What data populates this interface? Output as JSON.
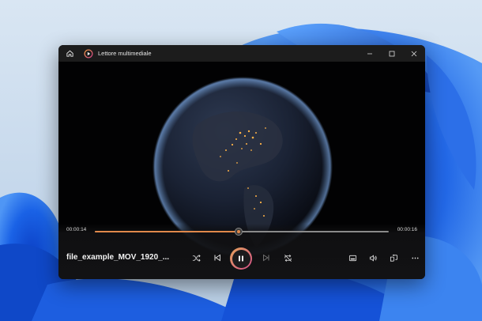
{
  "window": {
    "title": "Lettore multimediale",
    "icons": {
      "home": "home-icon",
      "app": "media-player-icon"
    },
    "controls": [
      "minimize",
      "maximize",
      "close"
    ]
  },
  "player": {
    "current_time": "00:00:14",
    "total_time": "00:00:16",
    "progress_fraction": 0.49,
    "file_name": "file_example_MOV_1920_...",
    "state": "playing",
    "accent_color": "#e0884a",
    "buttons": [
      "shuffle",
      "previous",
      "pause",
      "next",
      "repeat",
      "miniplayer",
      "volume",
      "cast",
      "more-options"
    ]
  },
  "colors": {
    "wallpaper_bloom": "#1a56d6",
    "window_bg": "#0f0f10",
    "titlebar_bg": "#1c1c1c"
  }
}
